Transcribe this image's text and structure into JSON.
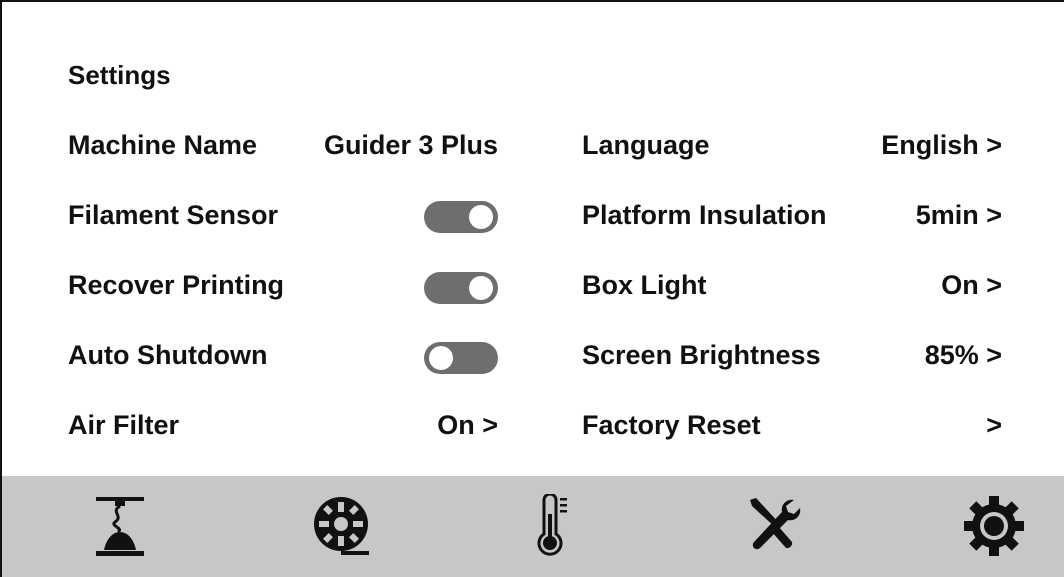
{
  "header": {
    "title": "Settings"
  },
  "left_rows": [
    {
      "label": "Machine Name",
      "value": "Guider 3 Plus"
    },
    {
      "label": "Filament Sensor",
      "toggle": "on"
    },
    {
      "label": "Recover Printing",
      "toggle": "on"
    },
    {
      "label": "Auto Shutdown",
      "toggle": "off"
    },
    {
      "label": "Air Filter",
      "value": "On >"
    }
  ],
  "right_rows": [
    {
      "label": "Language",
      "value": "English >"
    },
    {
      "label": "Platform Insulation",
      "value": "5min >"
    },
    {
      "label": "Box Light",
      "value": "On >"
    },
    {
      "label": "Screen Brightness",
      "value": "85% >"
    },
    {
      "label": "Factory Reset",
      "value": ">"
    }
  ],
  "bottom_nav": [
    {
      "icon": "print-icon"
    },
    {
      "icon": "filament-spool-icon"
    },
    {
      "icon": "thermometer-icon"
    },
    {
      "icon": "tools-icon"
    },
    {
      "icon": "gear-icon"
    }
  ],
  "colors": {
    "toggle_track": "#6e6e6e",
    "nav_bar": "#c7c7c7",
    "text": "#111111"
  }
}
